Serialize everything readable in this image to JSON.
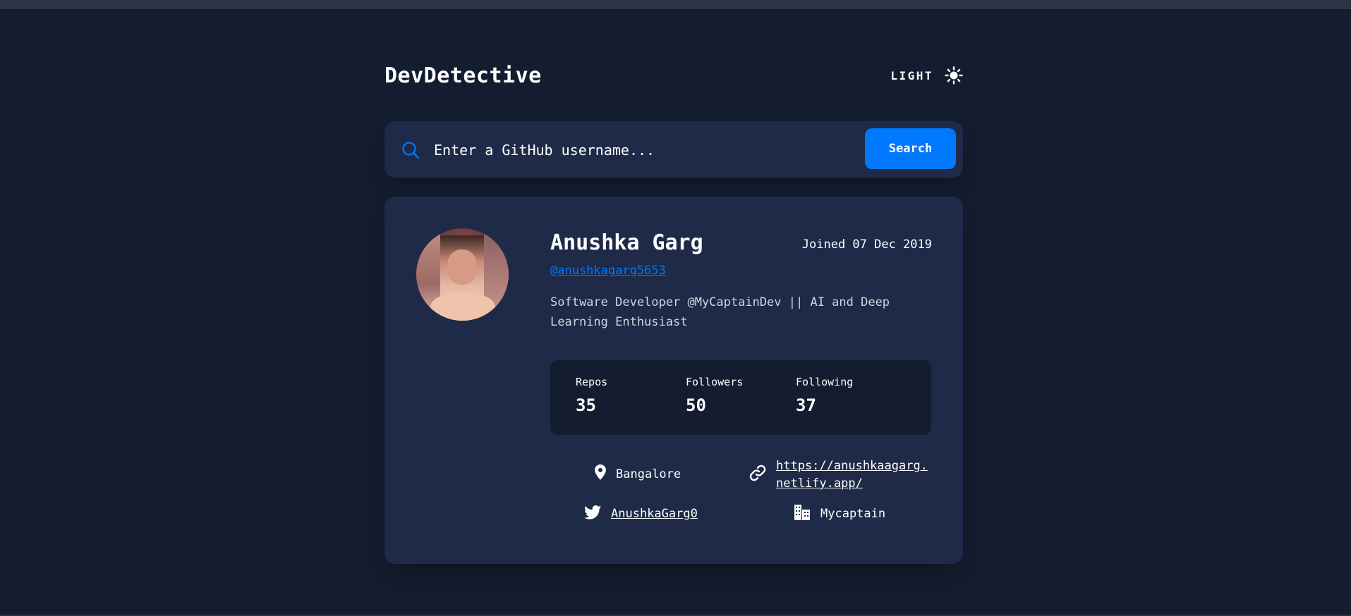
{
  "header": {
    "logo": "DevDetective",
    "mode_label": "LIGHT",
    "mode_icon": "sun-icon"
  },
  "search": {
    "icon": "search-icon",
    "placeholder": "Enter a GitHub username...",
    "value": "",
    "button_label": "Search"
  },
  "profile": {
    "avatar_icon": "avatar",
    "name": "Anushka Garg",
    "joined": "Joined 07 Dec 2019",
    "handle": "@anushkagarg5653",
    "bio_line1": "Software Developer @MyCaptainDev || AI and Deep",
    "bio_line2": "Learning Enthusiast"
  },
  "stats": [
    {
      "label": "Repos",
      "value": "35"
    },
    {
      "label": "Followers",
      "value": "50"
    },
    {
      "label": "Following",
      "value": "37"
    }
  ],
  "links": {
    "location": {
      "icon": "location-pin-icon",
      "text": "Bangalore"
    },
    "website": {
      "icon": "link-icon",
      "line1": "https://anushkaagarg.",
      "line2": "netlify.app/"
    },
    "twitter": {
      "icon": "twitter-icon",
      "text": "AnushkaGarg0"
    },
    "company": {
      "icon": "building-icon",
      "text": "Mycaptain"
    }
  },
  "colors": {
    "background": "#141d2f",
    "card": "#1e2a47",
    "accent": "#0079ff",
    "text": "#ffffff"
  }
}
